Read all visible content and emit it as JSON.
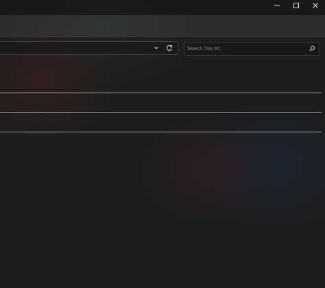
{
  "window": {
    "controls": [
      "minimize",
      "maximize",
      "close"
    ]
  },
  "address_bar": {
    "path": ""
  },
  "search": {
    "placeholder": "Search This PC",
    "value": ""
  },
  "icons": {
    "minimize": "minimize-icon",
    "maximize": "maximize-icon",
    "close": "close-icon",
    "chevron": "chevron-down-icon",
    "refresh": "refresh-icon",
    "search": "search-icon"
  },
  "colors": {
    "background": "#1d1d1e",
    "divider": "#bfc7c0",
    "control_glyph": "#e0e0e0"
  }
}
